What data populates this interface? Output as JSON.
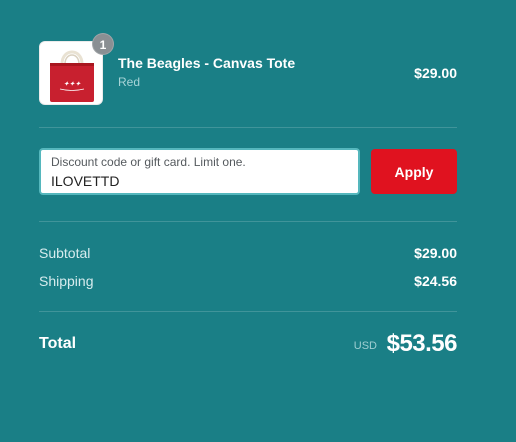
{
  "product": {
    "name": "The Beagles - Canvas Tote",
    "variant": "Red",
    "price": "$29.00",
    "quantity": "1",
    "image_icon": "tote-bag-image"
  },
  "discount": {
    "label": "Discount code or gift card. Limit one.",
    "value": "ILOVETTD",
    "apply_label": "Apply"
  },
  "summary": {
    "subtotal_label": "Subtotal",
    "subtotal_value": "$29.00",
    "shipping_label": "Shipping",
    "shipping_value": "$24.56"
  },
  "total": {
    "label": "Total",
    "currency": "USD",
    "value": "$53.56"
  },
  "colors": {
    "background": "#1a7f86",
    "apply_button": "#e0121f",
    "bag": "#c8202f"
  }
}
